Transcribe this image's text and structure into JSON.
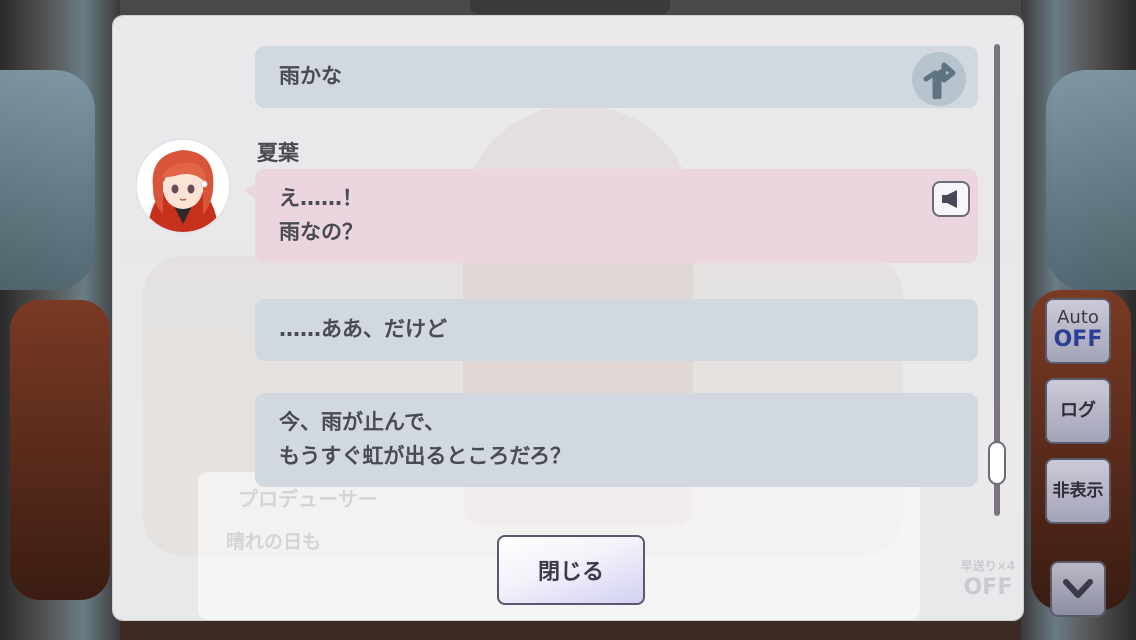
{
  "log": {
    "entries": [
      {
        "speaker": "",
        "lines": [
          "雨かな"
        ],
        "style": "choice",
        "icon": "branch-choice-icon"
      },
      {
        "speaker": "夏葉",
        "lines": [
          "え……！",
          "雨なの？"
        ],
        "style": "character",
        "icon": "speaker-voice-icon"
      },
      {
        "speaker": "",
        "lines": [
          "……ああ、だけど"
        ],
        "style": "choice"
      },
      {
        "speaker": "",
        "lines": [
          "今、雨が止んで、",
          "もうすぐ虹が出るところだろ？"
        ],
        "style": "choice"
      }
    ],
    "close_label": "閉じる"
  },
  "background_textbox": {
    "speaker": "プロデューサー",
    "line": "晴れの日も"
  },
  "side_buttons": {
    "auto_label": "Auto",
    "auto_state": "OFF",
    "log_label": "ログ",
    "hide_label": "非表示"
  },
  "speed_indicator": {
    "label": "早送り×4",
    "state": "OFF"
  },
  "colors": {
    "choice_bubble": "#d1d8df",
    "character_bubble": "#ebd6e0",
    "auto_off": "#2b3f96"
  }
}
